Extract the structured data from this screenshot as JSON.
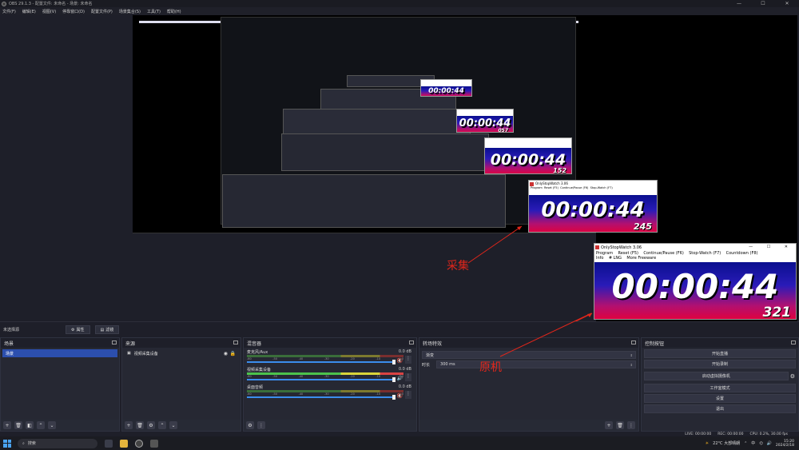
{
  "window": {
    "title": "OBS 29.1.3 - 配置文件: 未命名 - 场景: 未命名",
    "controls": [
      "—",
      "☐",
      "✕"
    ]
  },
  "menu": [
    "文件(F)",
    "编辑(E)",
    "视图(V)",
    "停靠窗口(D)",
    "配置文件(P)",
    "场景集合(S)",
    "工具(T)",
    "帮助(H)"
  ],
  "stopwatch": {
    "title": "OnlyStopWatch 3.06",
    "menu_row1": [
      "Program",
      "Reset  (F5)",
      "Continue/Pause (F6)",
      "Stop-Watch  (F7)",
      "Countdown  (F8)"
    ],
    "menu_row2": [
      "Info",
      "# LNG",
      "More Freeware"
    ],
    "time": "00:00:44",
    "ms_original": "321",
    "ms_captured": "245",
    "ms_nested_1": "152",
    "ms_nested_2": "057",
    "controls": [
      "—",
      "☐",
      "✕"
    ]
  },
  "annotations": {
    "capture": "采集",
    "original": "原机"
  },
  "source_bar": {
    "no_source": "未选择源",
    "properties": "属性",
    "filters": "滤镜"
  },
  "scenes": {
    "title": "场景",
    "items": [
      "场景"
    ]
  },
  "sources": {
    "title": "来源",
    "items": [
      "视频采集设备"
    ]
  },
  "mixer": {
    "title": "混音器",
    "scale": [
      "-60",
      "-55",
      "-50",
      "-45",
      "-40",
      "-35",
      "-30",
      "-25",
      "-20",
      "-15",
      "-10",
      "-5",
      "0"
    ],
    "channels": [
      {
        "name": "麦克风/Aux",
        "db": "0.0 dB",
        "muted": true
      },
      {
        "name": "视频采集设备",
        "db": "0.0 dB",
        "muted": false
      },
      {
        "name": "桌面音频",
        "db": "0.0 dB",
        "muted": true
      }
    ]
  },
  "transitions": {
    "title": "转场特效",
    "selected": "渐变",
    "duration_label": "时长",
    "duration_value": "300 ms"
  },
  "controls": {
    "title": "控制按钮",
    "buttons": [
      "开始直播",
      "开始录制",
      "启动虚拟摄像机",
      "工作室模式",
      "设置",
      "退出"
    ]
  },
  "status": {
    "live": "LIVE: 00:00:00",
    "rec": "REC: 00:00:00",
    "cpu": "CPU: 0.2%, 30.00 fps"
  },
  "taskbar": {
    "search": "搜索",
    "weather": "22°C  大部晴朗",
    "ime": "中",
    "time": "15:20",
    "date": "2024/2/18"
  },
  "colors": {
    "accent": "#2c4fae",
    "annotation": "#e0261b",
    "panel": "#272a35"
  }
}
